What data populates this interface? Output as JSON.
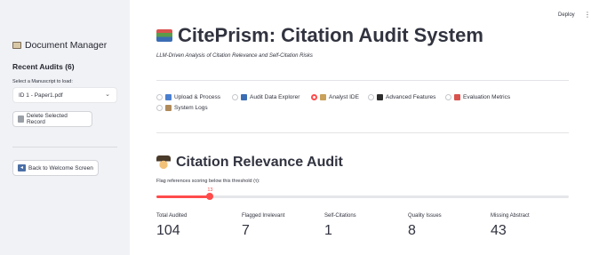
{
  "header": {
    "deploy_label": "Deploy",
    "menu_glyph": "⋮"
  },
  "sidebar": {
    "title": "Document Manager",
    "recent_audits": "Recent Audits (6)",
    "select_label": "Select a Manuscript to load:",
    "selected_value": "ID 1 - Paper1.pdf",
    "delete_label": "Delete Selected Record",
    "back_label": "Back to Welcome Screen"
  },
  "main": {
    "title": "CitePrism: Citation Audit System",
    "subtitle": "LLM-Driven Analysis of Citation Relevance and Self-Citation Risks",
    "tabs": [
      {
        "label": "Upload & Process",
        "selected": false,
        "icon": "inbox-tray-icon",
        "color": "#4a7fd0"
      },
      {
        "label": "Audit Data Explorer",
        "selected": false,
        "icon": "bar-chart-icon",
        "color": "#3b6db3"
      },
      {
        "label": "Analyst IDE",
        "selected": true,
        "icon": "detective-icon",
        "color": "#c9a15a"
      },
      {
        "label": "Advanced Features",
        "selected": false,
        "icon": "graduation-cap-icon",
        "color": "#2e2e2e"
      },
      {
        "label": "Evaluation Metrics",
        "selected": false,
        "icon": "line-chart-icon",
        "color": "#d9534f"
      },
      {
        "label": "System Logs",
        "selected": false,
        "icon": "scroll-icon",
        "color": "#b08a5a"
      }
    ],
    "section_title": "Citation Relevance Audit",
    "slider": {
      "label": "Flag references scoring below this threshold (τ):",
      "value": 13,
      "min": 0,
      "max": 100
    },
    "metrics": [
      {
        "label": "Total Audited",
        "value": "104"
      },
      {
        "label": "Flagged Irrelevant",
        "value": "7"
      },
      {
        "label": "Self-Citations",
        "value": "1"
      },
      {
        "label": "Quality Issues",
        "value": "8"
      },
      {
        "label": "Missing Abstract",
        "value": "43"
      }
    ],
    "accent_color": "#ff4b4b"
  }
}
